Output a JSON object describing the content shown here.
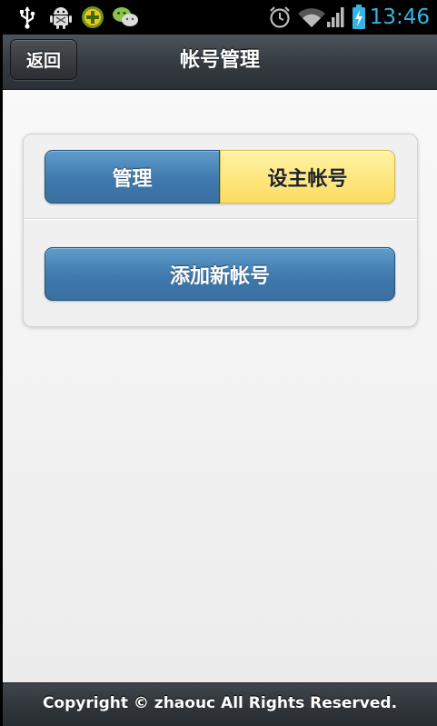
{
  "status_bar": {
    "time": "13:46",
    "icons": [
      "usb-icon",
      "android-debug-icon",
      "game-app-icon",
      "wechat-icon",
      "alarm-icon",
      "wifi-icon",
      "signal-icon",
      "battery-charging-icon"
    ]
  },
  "header": {
    "back_label": "返回",
    "title": "帐号管理"
  },
  "panel": {
    "segments": {
      "manage_label": "管理",
      "set_primary_label": "设主帐号"
    },
    "add_account_label": "添加新帐号"
  },
  "footer": {
    "copyright": "Copyright © zhaouc All Rights Reserved."
  },
  "colors": {
    "accent_blue": "#3f79ad",
    "active_yellow": "#fde57a",
    "clock_blue": "#33b5e5"
  }
}
